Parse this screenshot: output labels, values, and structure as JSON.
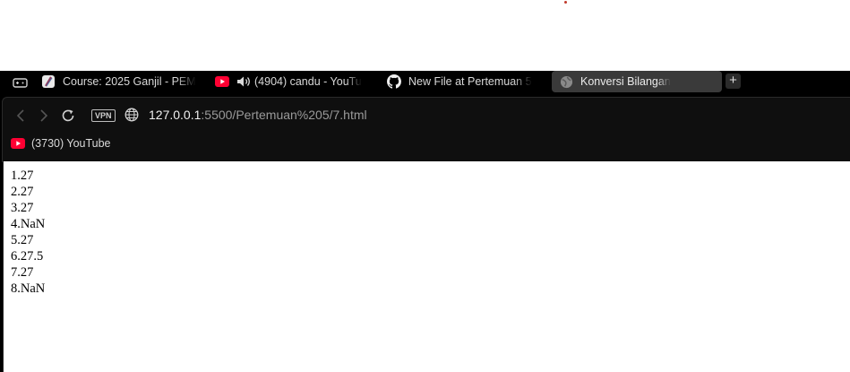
{
  "tabs": [
    {
      "title": "Course: 2025 Ganjil - PEM",
      "favicon": "course-icon"
    },
    {
      "title": "(4904) candu - YouTu",
      "favicon": "youtube-icon",
      "audio": "speaker-icon",
      "active": true
    },
    {
      "title": "New File at Pertemuan 5",
      "favicon": "github-icon"
    },
    {
      "title": "Konversi Bilangan",
      "favicon": "globe-icon",
      "selected": true
    }
  ],
  "new_tab_label": "+",
  "toolbar": {
    "vpn_label": "VPN",
    "url_host": "127.0.0.1",
    "url_rest": ":5500/Pertemuan%205/7.html"
  },
  "bookmarks": [
    {
      "label": "(3730) YouTube",
      "favicon": "youtube-icon"
    }
  ],
  "output": [
    "1.27",
    "2.27",
    "3.27",
    "4.NaN",
    "5.27",
    "6.27.5",
    "7.27",
    "8.NaN"
  ],
  "colors": {
    "youtube_red": "#ff0033",
    "tab_selected_bg": "#3a3a3a",
    "toolbar_bg": "#0f0f0f"
  }
}
